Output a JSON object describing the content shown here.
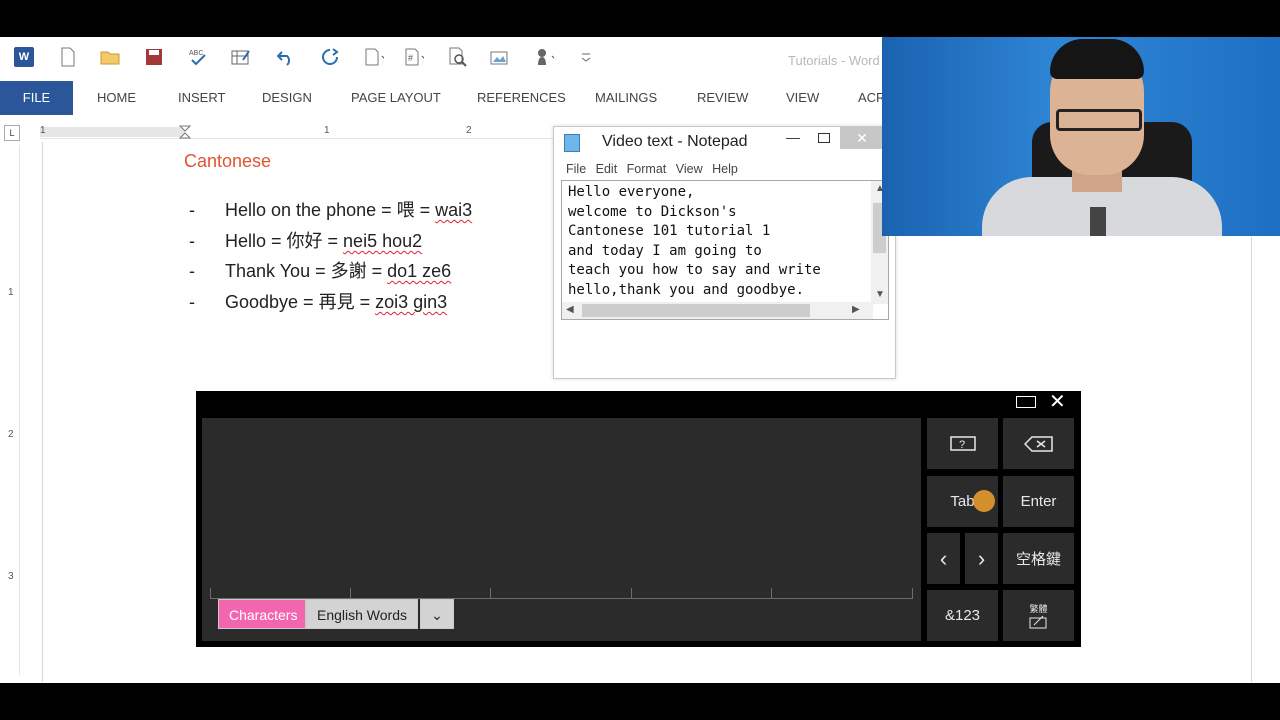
{
  "word": {
    "title": "Tutorials - Word",
    "tabs": [
      "FILE",
      "HOME",
      "INSERT",
      "DESIGN",
      "PAGE LAYOUT",
      "REFERENCES",
      "MAILINGS",
      "REVIEW",
      "VIEW",
      "ACR"
    ],
    "ruler": {
      "corner": "L",
      "h_numbers": [
        "1",
        "1",
        "2"
      ],
      "v_numbers": [
        "1",
        "2",
        "3"
      ]
    }
  },
  "document": {
    "heading": "Cantonese",
    "lines": [
      {
        "bullet": "-",
        "text": "Hello on the phone = 喂 = ",
        "romanization": "wai3"
      },
      {
        "bullet": "-",
        "text": "Hello = 你好 = ",
        "romanization": "nei5 hou2"
      },
      {
        "bullet": "-",
        "text": "Thank You = 多謝 = ",
        "romanization": "do1 ze6"
      },
      {
        "bullet": "-",
        "text": "Goodbye = 再見 = ",
        "romanization": "zoi3 gin3"
      }
    ]
  },
  "notepad": {
    "title": "Video text - Notepad",
    "menu": [
      "File",
      "Edit",
      "Format",
      "View",
      "Help"
    ],
    "content": "Hello everyone,\nwelcome to Dickson's\nCantonese 101 tutorial 1\nand today I am going to\nteach you how to say and write\nhello,thank you and goodbye."
  },
  "handwriting_panel": {
    "modes": {
      "characters": "Characters",
      "english_words": "English Words",
      "dropdown": "⌄"
    },
    "keys": {
      "help": "?",
      "backspace": "⌫",
      "tab": "Tab",
      "enter": "Enter",
      "left": "‹",
      "right": "›",
      "space": "空格鍵",
      "symbols": "&123",
      "ime": "繁體"
    },
    "active_mode_color": "#f266b0"
  }
}
